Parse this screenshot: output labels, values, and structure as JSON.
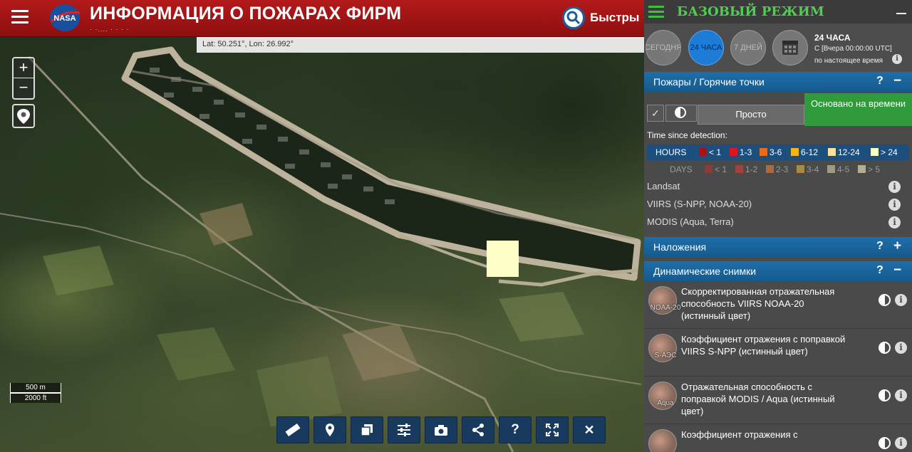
{
  "header": {
    "title": "ИНФОРМАЦИЯ О ПОЖАРАХ ФИРМ",
    "subtitle": "· ·.... · · · ·",
    "logo_text": "NASA",
    "quick_button": "Быстры"
  },
  "map": {
    "coords": "Lat: 50.251°, Lon: 26.992°",
    "zoom_in": "+",
    "zoom_out": "−",
    "scale_m": "500 m",
    "scale_ft": "2000 ft"
  },
  "toolbar": {
    "items": [
      "ruler-icon",
      "marker-icon",
      "layers-icon",
      "sliders-icon",
      "camera-icon",
      "share-icon",
      "help-icon",
      "fullscreen-icon",
      "close-icon"
    ],
    "help_label": "?",
    "close_label": "✕"
  },
  "panel": {
    "title": "БАЗОВЫЙ РЕЖИМ",
    "time_options": [
      {
        "label": "СЕГОДНЯ",
        "active": false
      },
      {
        "label": "24 ЧАСА",
        "active": true
      },
      {
        "label": "7 ДНЕЙ",
        "active": false
      }
    ],
    "time_heading": "24 ЧАСА",
    "time_from": "С [Вчера 00:00:00 UTC]",
    "time_to": "по настоящее время",
    "fires_section": {
      "label": "Пожары / Горячие точки",
      "help": "?",
      "toggle": "−"
    },
    "mode": {
      "simple": "Просто",
      "time_based": "Основано на времени"
    },
    "legend": {
      "title": "Time since detection:",
      "hours_label": "HOURS",
      "hours": [
        {
          "label": "< 1",
          "color": "#b01010"
        },
        {
          "label": "1-3",
          "color": "#e0141c"
        },
        {
          "label": "3-6",
          "color": "#ea6c12"
        },
        {
          "label": "6-12",
          "color": "#f4b41a"
        },
        {
          "label": "12-24",
          "color": "#f9e29a"
        },
        {
          "label": "> 24",
          "color": "#fdfdc8"
        }
      ],
      "days_label": "DAYS",
      "days": [
        {
          "label": "< 1",
          "color": "#8e3a3a"
        },
        {
          "label": "1-2",
          "color": "#a0423f"
        },
        {
          "label": "2-3",
          "color": "#a86b42"
        },
        {
          "label": "3-4",
          "color": "#a88a46"
        },
        {
          "label": "4-5",
          "color": "#a09a80"
        },
        {
          "label": "> 5",
          "color": "#b4ae96"
        }
      ]
    },
    "sources": [
      "Landsat",
      "VIIRS (S-NPP, NOAA-20)",
      "MODIS (Aqua, Terra)"
    ],
    "overlays_section": {
      "label": "Наложения",
      "help": "?",
      "toggle": "+"
    },
    "imagery_section": {
      "label": "Динамические снимки",
      "help": "?",
      "toggle": "−"
    },
    "imagery": [
      {
        "caption": "NOAA-20",
        "text": "Скорректированная отражательная способность VIIRS NOAA-20 (истинный цвет)"
      },
      {
        "caption": "S-АЭС",
        "text": "Коэффициент отражения с поправкой VIIRS S-NPP (истинный цвет)"
      },
      {
        "caption": "Aqua",
        "text": "Отражательная способность с поправкой MODIS / Aqua (истинный цвет)"
      },
      {
        "caption": "",
        "text": "Коэффициент отражения с"
      }
    ]
  }
}
